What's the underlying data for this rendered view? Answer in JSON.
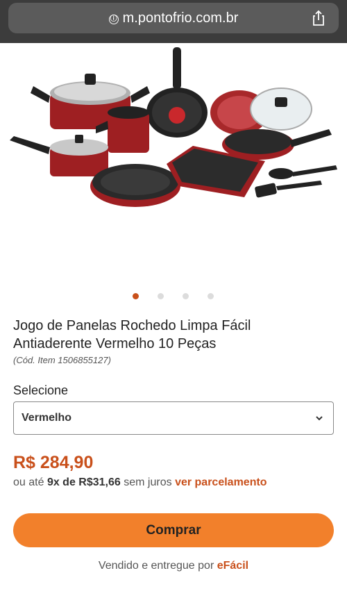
{
  "browser": {
    "url": "m.pontofrio.com.br",
    "info_icon": "ⓘ",
    "share_icon": "share-icon"
  },
  "gallery": {
    "image_subject": "cookware-set",
    "dots_count": 4,
    "active_dot": 1
  },
  "product": {
    "title": "Jogo de Panelas Rochedo Limpa Fácil Antiaderente Vermelho 10 Peças",
    "code": "(Cód. Item 1506855127)"
  },
  "variant": {
    "label": "Selecione",
    "selected": "Vermelho"
  },
  "pricing": {
    "price": "R$ 284,90",
    "installment_prefix": "ou até",
    "installment_terms": "9x de R$31,66",
    "installment_suffix": "sem juros",
    "installment_link": "ver parcelamento"
  },
  "actions": {
    "buy_label": "Comprar"
  },
  "seller": {
    "prefix": "Vendido e entregue por",
    "name": "eFácil"
  },
  "colors": {
    "accent": "#c9501b",
    "button": "#f2802b",
    "pan_red": "#9e1f22"
  }
}
